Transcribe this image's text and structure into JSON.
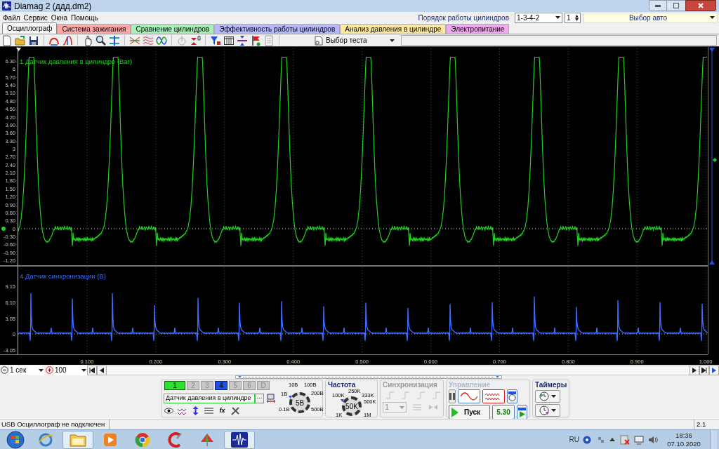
{
  "window": {
    "title": "Diamag 2 (ддд.dm2)"
  },
  "menu": [
    "Файл",
    "Сервис",
    "Окна",
    "Помощь"
  ],
  "cylinder_order": {
    "label": "Порядок работы цилиндров",
    "value": "1-3-4-2",
    "spinner_value": "1"
  },
  "car_select": {
    "value": "Выбор авто"
  },
  "tabs": [
    {
      "label": "Осциллограф",
      "selected": true,
      "color": "#f7f7f7"
    },
    {
      "label": "Система зажигания",
      "selected": false,
      "color": "#ffa8a8"
    },
    {
      "label": "Сравнение цилиндров",
      "selected": false,
      "color": "#a8f0b8"
    },
    {
      "label": "Эффективность работы цилиндров",
      "selected": false,
      "color": "#b8b8ff"
    },
    {
      "label": "Анализ давления в цилиндре",
      "selected": false,
      "color": "#ffe8a0"
    },
    {
      "label": "Электропитание",
      "selected": false,
      "color": "#f0a8f0"
    }
  ],
  "toolbar": {
    "test_select": "Выбор теста"
  },
  "scope": {
    "channels": [
      {
        "title": "1 Датчик давления в цилиндре (Bar)",
        "color": "#22d022",
        "y_ticks": [
          "6.30",
          "6",
          "5.70",
          "5.40",
          "5.10",
          "4.80",
          "4.50",
          "4.20",
          "3.90",
          "3.60",
          "3.30",
          "3",
          "2.70",
          "2.40",
          "2.10",
          "1.80",
          "1.50",
          "1.20",
          "0.90",
          "0.60",
          "0.30",
          "0",
          "-0.30",
          "-0.60",
          "-0.90",
          "-1.20"
        ]
      },
      {
        "title": "4 Датчик синхронизации (В)",
        "color": "#3a6cff",
        "y_ticks": [
          "9.15",
          "6.10",
          "3.05",
          "0",
          "-3.05"
        ]
      }
    ],
    "x_ticks": [
      "0.100",
      "0.200",
      "0.300",
      "0.400",
      "0.500",
      "0.600",
      "0.700",
      "0.800",
      "0.900",
      "1.000"
    ]
  },
  "timebase": {
    "value": "1 сек"
  },
  "zoom": {
    "value": "100"
  },
  "control_panel": {
    "channel_buttons": [
      {
        "label": "1",
        "on": true,
        "selected": false
      },
      {
        "label": "2",
        "on": false,
        "selected": false
      },
      {
        "label": "3",
        "on": false,
        "selected": false
      },
      {
        "label": "4",
        "on": true,
        "selected": true
      },
      {
        "label": "5",
        "on": false,
        "selected": false
      },
      {
        "label": "6",
        "on": false,
        "selected": false
      },
      {
        "label": "D",
        "on": false,
        "selected": false
      }
    ],
    "sensor_field": {
      "value": "Датчик давления в цилиндре",
      "browse_label": "···"
    },
    "formula_label": "fx",
    "voltage_knob": {
      "value": "5В",
      "labels": [
        "10В",
        "100В",
        "1В",
        "200В",
        "0.1В",
        "500В"
      ]
    },
    "frequency": {
      "title": "Частота",
      "value": "50K",
      "labels": [
        "250K",
        "100K",
        "333K",
        "500K",
        "1K",
        "1M"
      ]
    },
    "sync": {
      "title": "Синхронизация",
      "select_value": "1",
      "disabled": true
    },
    "control": {
      "title": "Управление",
      "start_label": "Пуск",
      "reading": "5.30"
    },
    "timers": {
      "title": "Таймеры"
    }
  },
  "status_bar": {
    "message": "USB Осциллограф не подключен",
    "version": "2.1"
  },
  "taskbar": {
    "language": "RU",
    "time": "18:36",
    "date": "07.10.2020"
  }
}
